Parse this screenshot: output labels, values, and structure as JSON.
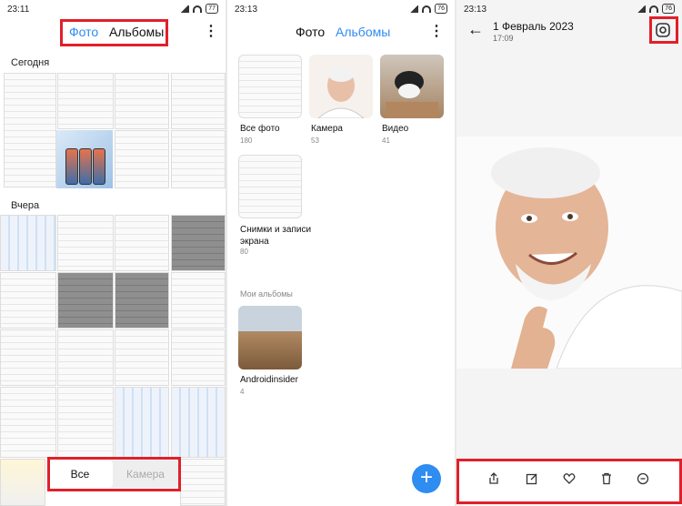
{
  "panel1": {
    "status": {
      "time": "23:11",
      "battery": "77"
    },
    "tabs": {
      "photos": "Фото",
      "albums": "Альбомы"
    },
    "more": "⋮",
    "sections": {
      "today": "Сегодня",
      "yesterday": "Вчера"
    },
    "segment": {
      "all": "Все",
      "camera": "Камера"
    }
  },
  "panel2": {
    "status": {
      "time": "23:13",
      "battery": "76"
    },
    "tabs": {
      "photos": "Фото",
      "albums": "Альбомы"
    },
    "more": "⋮",
    "albums": [
      {
        "name": "Все фото",
        "count": "180"
      },
      {
        "name": "Камера",
        "count": "53"
      },
      {
        "name": "Видео",
        "count": "41"
      },
      {
        "name": "Снимки и записи экрана",
        "count": "80"
      }
    ],
    "my_albums_title": "Мои альбомы",
    "my_albums": [
      {
        "name": "Androidinsider",
        "count": "4"
      }
    ],
    "fab": "+"
  },
  "panel3": {
    "status": {
      "time": "23:13",
      "battery": "76"
    },
    "back": "←",
    "date": "1 Февраль 2023",
    "time": "17:09",
    "lens_icon": "google-lens-icon",
    "actions": [
      "share-icon",
      "edit-icon",
      "heart-icon",
      "trash-icon",
      "more-icon"
    ]
  },
  "colors": {
    "accent": "#2f8cf0",
    "highlight": "#e0202a"
  }
}
